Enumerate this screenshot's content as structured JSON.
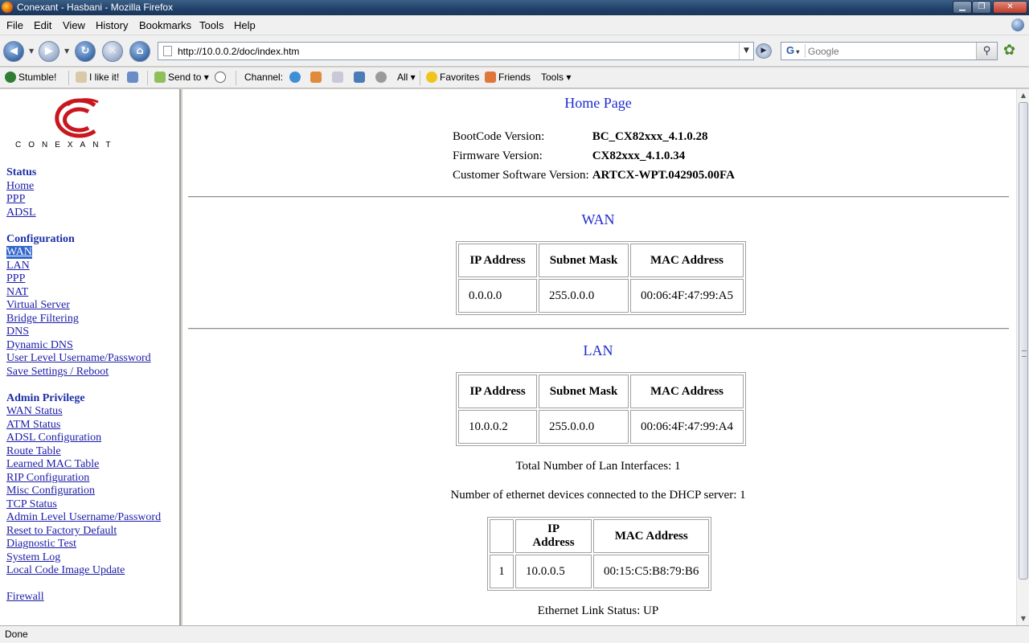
{
  "window": {
    "title": "Conexant - Hasbani - Mozilla Firefox"
  },
  "menu": [
    "File",
    "Edit",
    "View",
    "History",
    "Bookmarks",
    "Tools",
    "Help"
  ],
  "nav": {
    "url": "http://10.0.0.2/doc/index.htm",
    "search_placeholder": "Google",
    "search_engine": "G"
  },
  "stumble": {
    "stumble_label": "Stumble!",
    "like_label": "I like it!",
    "send_label": "Send to",
    "channel_label": "Channel:",
    "all_label": "All",
    "favorites_label": "Favorites",
    "friends_label": "Friends",
    "tools_label": "Tools"
  },
  "sidebar": {
    "logo_text": "CONEXANT",
    "sections": [
      {
        "heading": "Status",
        "links": [
          "Home",
          "PPP",
          "ADSL"
        ]
      },
      {
        "heading": "Configuration",
        "links": [
          "WAN",
          "LAN",
          "PPP",
          "NAT",
          "Virtual Server",
          "Bridge Filtering",
          "DNS",
          "Dynamic DNS",
          "User Level Username/Password",
          "Save Settings / Reboot"
        ]
      },
      {
        "heading": "Admin Privilege",
        "links": [
          "WAN Status",
          "ATM Status",
          "ADSL Configuration",
          "Route Table",
          "Learned MAC Table",
          "RIP Configuration",
          "Misc Configuration",
          "TCP Status",
          "Admin Level Username/Password",
          "Reset to Factory Default",
          "Diagnostic Test",
          "System Log",
          "Local Code Image Update"
        ]
      },
      {
        "heading": "",
        "links": [
          "Firewall"
        ]
      }
    ],
    "active_link": "WAN"
  },
  "main": {
    "title": "Home Page",
    "versions": [
      {
        "label": "BootCode Version:",
        "value": "BC_CX82xxx_4.1.0.28"
      },
      {
        "label": "Firmware Version:",
        "value": "CX82xxx_4.1.0.34"
      },
      {
        "label": "Customer Software Version:",
        "value": "ARTCX-WPT.042905.00FA"
      }
    ],
    "wan": {
      "title": "WAN",
      "headers": [
        "IP Address",
        "Subnet Mask",
        "MAC Address"
      ],
      "row": [
        "0.0.0.0",
        "255.0.0.0",
        "00:06:4F:47:99:A5"
      ]
    },
    "lan": {
      "title": "LAN",
      "headers": [
        "IP Address",
        "Subnet Mask",
        "MAC Address"
      ],
      "row": [
        "10.0.0.2",
        "255.0.0.0",
        "00:06:4F:47:99:A4"
      ]
    },
    "total_lan": "Total Number of Lan Interfaces: 1",
    "dhcp_count": "Number of ethernet devices connected to the DHCP server: 1",
    "dhcp": {
      "headers": [
        "",
        "IP Address",
        "MAC Address"
      ],
      "row": [
        "1",
        "10.0.0.5",
        "00:15:C5:B8:79:B6"
      ]
    },
    "link_status": "Ethernet Link Status: UP"
  },
  "status_bar": "Done"
}
